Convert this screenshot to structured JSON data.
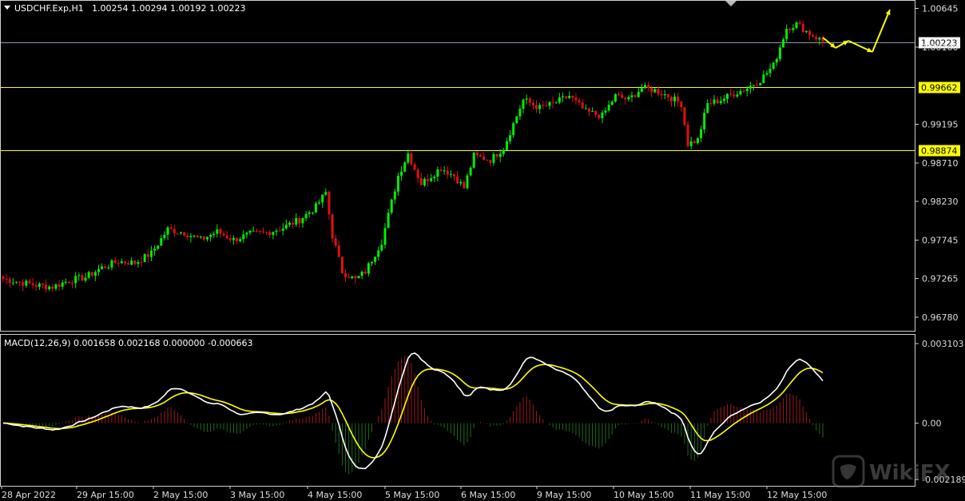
{
  "header": {
    "symbol": "USDCHF.Exp,H1",
    "ohlc": "1.00254 1.00294 1.00192 1.00223",
    "menu_icon": "triangle-down-icon"
  },
  "price_axis": {
    "ticks": [
      "1.00645",
      "1.00160",
      "0.99195",
      "0.98710",
      "0.98230",
      "0.97745",
      "0.97265",
      "0.96780"
    ],
    "tick_values": [
      1.00645,
      1.0016,
      0.99195,
      0.9871,
      0.9823,
      0.97745,
      0.97265,
      0.9678
    ],
    "ylim": [
      0.9662,
      1.0073
    ]
  },
  "levels": {
    "current": {
      "label": "1.00223",
      "value": 1.00223,
      "color": "#8a9ab0"
    },
    "resistance": {
      "label": "0.99662",
      "value": 0.99662,
      "color": "#ffff00"
    },
    "support": {
      "label": "0.98874",
      "value": 0.98874,
      "color": "#ffff00"
    }
  },
  "macd": {
    "title": "MACD(12,26,9) 0.001658 0.002168 0.000000 -0.000663",
    "ticks": [
      "0.003103",
      "0.00",
      "-0.002189"
    ],
    "tick_values": [
      0.003103,
      0.0,
      -0.002189
    ],
    "ylim": [
      -0.0024,
      0.0034
    ],
    "colors": {
      "macd": "#ffffff",
      "signal": "#ffff00",
      "hist_up": "#a01818",
      "hist_down": "#1f6b1f"
    }
  },
  "time_axis": {
    "labels": [
      "28 Apr 2022",
      "29 Apr 15:00",
      "2 May 15:00",
      "3 May 15:00",
      "4 May 15:00",
      "5 May 15:00",
      "6 May 15:00",
      "9 May 15:00",
      "10 May 15:00",
      "11 May 15:00",
      "12 May 15:00"
    ]
  },
  "watermark": {
    "text": "WikiFX",
    "icon": "wikifx-logo-icon"
  },
  "colors": {
    "bull": "#00ee00",
    "bear": "#e01010",
    "grid": "#444444",
    "projection": "#ffff00"
  },
  "chart_data": {
    "type": "candlestick",
    "title": "USDCHF.Exp,H1",
    "y_range": [
      0.9662,
      1.0073
    ],
    "anchors": [
      [
        0,
        0.9726
      ],
      [
        5,
        0.9722
      ],
      [
        10,
        0.9718
      ],
      [
        15,
        0.9716
      ],
      [
        20,
        0.9724
      ],
      [
        25,
        0.9728
      ],
      [
        30,
        0.974
      ],
      [
        35,
        0.9748
      ],
      [
        40,
        0.9746
      ],
      [
        45,
        0.9758
      ],
      [
        50,
        0.9788
      ],
      [
        55,
        0.9784
      ],
      [
        60,
        0.9775
      ],
      [
        65,
        0.9785
      ],
      [
        70,
        0.9775
      ],
      [
        75,
        0.9782
      ],
      [
        80,
        0.9784
      ],
      [
        85,
        0.979
      ],
      [
        90,
        0.98
      ],
      [
        95,
        0.9816
      ],
      [
        98,
        0.9834
      ],
      [
        100,
        0.978
      ],
      [
        103,
        0.9735
      ],
      [
        107,
        0.9725
      ],
      [
        110,
        0.9735
      ],
      [
        115,
        0.9773
      ],
      [
        120,
        0.9855
      ],
      [
        123,
        0.9883
      ],
      [
        127,
        0.9845
      ],
      [
        133,
        0.9865
      ],
      [
        137,
        0.9855
      ],
      [
        140,
        0.984
      ],
      [
        143,
        0.988
      ],
      [
        148,
        0.9875
      ],
      [
        152,
        0.989
      ],
      [
        158,
        0.995
      ],
      [
        163,
        0.994
      ],
      [
        167,
        0.9945
      ],
      [
        172,
        0.9955
      ],
      [
        177,
        0.9935
      ],
      [
        182,
        0.993
      ],
      [
        186,
        0.9955
      ],
      [
        190,
        0.995
      ],
      [
        194,
        0.9965
      ],
      [
        198,
        0.9962
      ],
      [
        202,
        0.9955
      ],
      [
        206,
        0.9945
      ],
      [
        208,
        0.9895
      ],
      [
        211,
        0.99
      ],
      [
        214,
        0.9945
      ],
      [
        218,
        0.995
      ],
      [
        222,
        0.9958
      ],
      [
        226,
        0.9965
      ],
      [
        230,
        0.9975
      ],
      [
        234,
        0.9993
      ],
      [
        238,
        1.004
      ],
      [
        241,
        1.0045
      ],
      [
        245,
        1.0033
      ],
      [
        249,
        1.0023
      ]
    ],
    "projection": [
      {
        "from": 1.0028,
        "to": 1.0015
      },
      {
        "from": 1.0015,
        "to": 1.0024
      },
      {
        "from": 1.0024,
        "to": 1.001
      },
      {
        "from": 1.001,
        "to": 1.0063
      }
    ]
  }
}
